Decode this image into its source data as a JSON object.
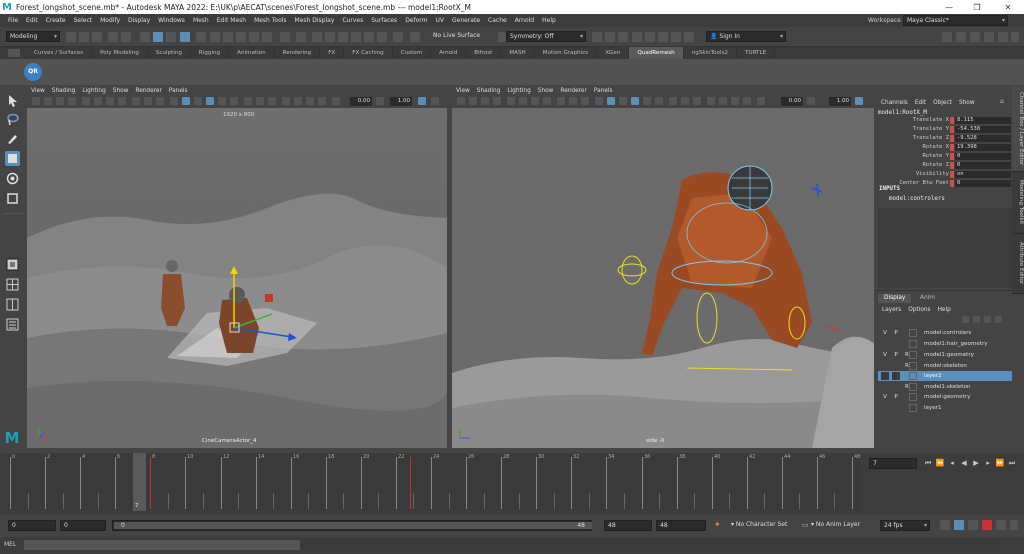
{
  "window": {
    "title": "Forest_longshot_scene.mb* - Autodesk MAYA 2022: E:\\UK\\p\\AECAT\\scenes\\Forest_longshot_scene.mb   ---   model1:RootX_M",
    "minimize": "—",
    "maximize": "❐",
    "close": "✕"
  },
  "menubar": [
    "File",
    "Edit",
    "Create",
    "Select",
    "Modify",
    "Display",
    "Windows",
    "Mesh",
    "Edit Mesh",
    "Mesh Tools",
    "Mesh Display",
    "Curves",
    "Surfaces",
    "Deform",
    "UV",
    "Generate",
    "Cache",
    "Arnold",
    "Help"
  ],
  "workspace": {
    "label": "Workspace :",
    "value": "Maya Classic*"
  },
  "statusline": {
    "menuset": "Modeling",
    "live_surface": "No Live Surface",
    "symmetry": "Symmetry: Off",
    "sign_in": "Sign In"
  },
  "shelf_tabs": [
    "Curves / Surfaces",
    "Poly Modeling",
    "Sculpting",
    "Rigging",
    "Animation",
    "Rendering",
    "FX",
    "FX Caching",
    "Custom",
    "Arnold",
    "Bifrost",
    "MASH",
    "Motion Graphics",
    "XGen",
    "QuadRemesh",
    "ngSkinTools2",
    "TURTLE"
  ],
  "shelf_active": "QuadRemesh",
  "shelf_icon": "QR",
  "viewport_menu": [
    "View",
    "Shading",
    "Lighting",
    "Show",
    "Renderer",
    "Panels"
  ],
  "viewport_left": {
    "resolution": "1920 x 800",
    "camera": "CineCameraActor_4",
    "field1": "0.00",
    "field2": "1.00"
  },
  "viewport_right": {
    "camera": "side -X",
    "field1": "0.00",
    "field2": "1.00"
  },
  "channel_box": {
    "menu": [
      "Channels",
      "Edit",
      "Object",
      "Show"
    ],
    "object": "model1:RootX_M",
    "attributes": [
      {
        "name": "Translate X",
        "value": "8.115"
      },
      {
        "name": "Translate Y",
        "value": "-54.538"
      },
      {
        "name": "Translate Z",
        "value": "-9.528"
      },
      {
        "name": "Rotate X",
        "value": "19.398"
      },
      {
        "name": "Rotate Y",
        "value": "0"
      },
      {
        "name": "Rotate Z",
        "value": "0"
      },
      {
        "name": "Visibility",
        "value": "on"
      },
      {
        "name": "Center Btw Feet",
        "value": "0"
      }
    ],
    "inputs_label": "INPUTS",
    "inputs_item": "model:controlers"
  },
  "side_tabs": [
    "Channel Box / Layer Editor",
    "Modeling Toolkit",
    "Attribute Editor"
  ],
  "layer_editor": {
    "tabs": [
      "Display",
      "Anim"
    ],
    "menu": [
      "Layers",
      "Options",
      "Help"
    ],
    "layers": [
      {
        "v": "V",
        "p": "P",
        "r": "",
        "name": "model:controlers",
        "selected": false
      },
      {
        "v": "",
        "p": "",
        "r": "",
        "name": "model1:hair_geometry",
        "selected": false
      },
      {
        "v": "V",
        "p": "P",
        "r": "R",
        "name": "model1:geometry",
        "selected": false
      },
      {
        "v": "",
        "p": "",
        "r": "R",
        "name": "model:skeleton",
        "selected": false
      },
      {
        "v": "",
        "p": "",
        "r": "",
        "name": "layer2",
        "selected": true
      },
      {
        "v": "",
        "p": "",
        "r": "R",
        "name": "model1:skeleton",
        "selected": false
      },
      {
        "v": "V",
        "p": "P",
        "r": "",
        "name": "model:geometry",
        "selected": false
      },
      {
        "v": "",
        "p": "",
        "r": "",
        "name": "layer1",
        "selected": false
      }
    ]
  },
  "timeline": {
    "ticks": [
      "0",
      "2",
      "4",
      "6",
      "8",
      "10",
      "12",
      "14",
      "16",
      "18",
      "20",
      "22",
      "24",
      "26",
      "28",
      "30",
      "32",
      "34",
      "36",
      "38",
      "40",
      "42",
      "44",
      "46",
      "48"
    ],
    "current_frame": "7",
    "current_field": "7"
  },
  "range": {
    "start": "0",
    "start_inner": "0",
    "slider_start": "0",
    "slider_end": "48",
    "end_inner": "48",
    "end": "48",
    "character_set": "No Character Set",
    "anim_layer": "No Anim Layer",
    "fps": "24 fps"
  },
  "command_line": {
    "label": "MEL"
  }
}
